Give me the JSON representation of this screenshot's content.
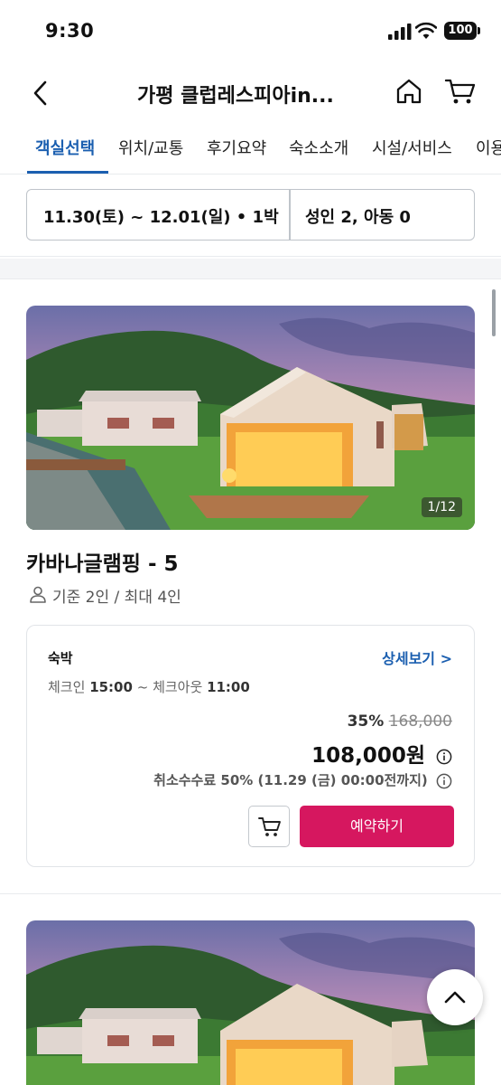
{
  "status_bar": {
    "time": "9:30",
    "battery": "100"
  },
  "header": {
    "title": "가평 클럽레스피아in...",
    "back_icon": "chevron-left-icon",
    "home_icon": "home-icon",
    "cart_icon": "cart-icon"
  },
  "tabs": [
    {
      "label": "객실선택",
      "active": true
    },
    {
      "label": "위치/교통"
    },
    {
      "label": "후기요약"
    },
    {
      "label": "숙소소개"
    },
    {
      "label": "시설/서비스"
    },
    {
      "label": "이용"
    }
  ],
  "search": {
    "dates": "11.30(토) ~ 12.01(일) • 1박",
    "guests": "성인 2, 아동 0"
  },
  "room": {
    "photo_counter": "1/12",
    "name": "카바나글램핑 - 5",
    "capacity": "기준 2인 / 최대 4인",
    "stay_type": "숙박",
    "detail_link": "상세보기 >",
    "checkin_label": "체크인",
    "checkin_time": "15:00",
    "separator": "~",
    "checkout_label": "체크아웃",
    "checkout_time": "11:00",
    "discount": "35%",
    "original_price": "168,000",
    "price": "108,000원",
    "cancel_fee": "취소수수료 50% (11.29 (금) 00:00전까지)",
    "book_label": "예약하기"
  },
  "colors": {
    "accent": "#1b5fb0",
    "book_button": "#d6175f"
  }
}
